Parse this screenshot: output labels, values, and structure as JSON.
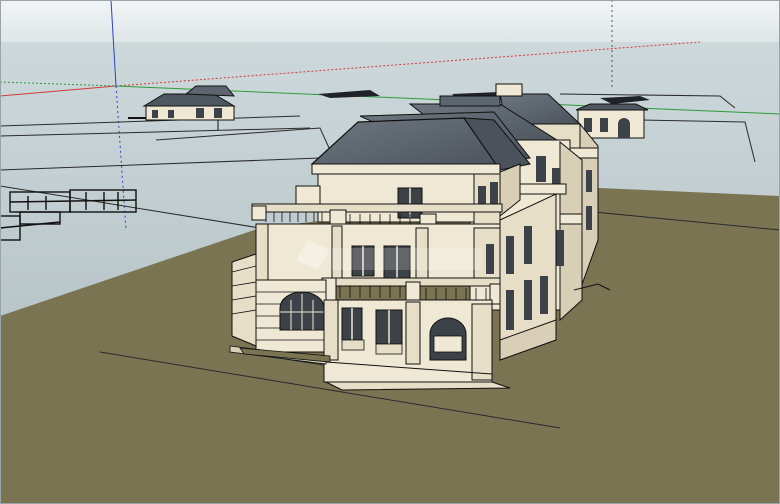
{
  "scene": {
    "colors": {
      "sky_top": "#e9eef0",
      "sky_bottom": "#cfdadd",
      "ground_plane": "#c7d3d6",
      "terrain": "#7a7453",
      "wall": "#efe8d4",
      "wall_shadow": "#d8cfb6",
      "roof": "#5d6670",
      "roof_dark": "#474e56",
      "window": "#3d4248",
      "outline": "#1a1a1a",
      "axis_red": "#d23a3a",
      "axis_green": "#2f9b3a",
      "axis_blue": "#2f3fd0"
    },
    "icons": [
      "villa-model",
      "axis-guides",
      "floor-plan-drawings",
      "watermark-logo"
    ]
  }
}
